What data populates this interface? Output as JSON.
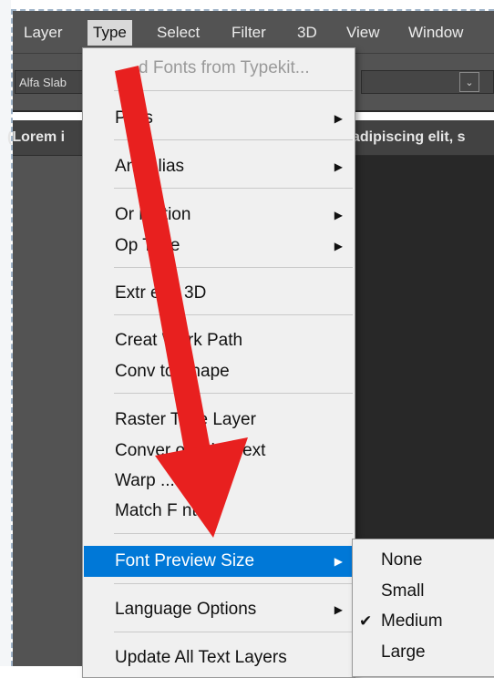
{
  "menubar": {
    "items": [
      "Layer",
      "Type",
      "Select",
      "Filter",
      "3D",
      "View",
      "Window"
    ]
  },
  "options": {
    "font": "Alfa Slab"
  },
  "document": {
    "text_left": "(Lorem i",
    "text_right": "adipiscing elit, s"
  },
  "type_menu": {
    "items": [
      {
        "label": "d Fonts from Typekit..."
      },
      {
        "label": "P  els"
      },
      {
        "label": "An  -Alias"
      },
      {
        "label": "Or  ntation"
      },
      {
        "label": "Op  Type"
      },
      {
        "label": "Extr   e to 3D"
      },
      {
        "label": "Creat  Work Path"
      },
      {
        "label": "Conv   to Shape"
      },
      {
        "label": "Raster   Type Layer"
      },
      {
        "label": "Conver   o Point Text"
      },
      {
        "label": "Warp     ..."
      },
      {
        "label": "Match F   nt..."
      },
      {
        "label": "Font Preview Size"
      },
      {
        "label": "Language Options"
      },
      {
        "label": "Update All Text Layers"
      }
    ]
  },
  "preview_submenu": {
    "items": [
      "None",
      "Small",
      "Medium",
      "Large"
    ],
    "checked": "Medium"
  },
  "colors": {
    "highlight": "#0078d7",
    "arrow": "#e8201f"
  },
  "icons": {
    "submenu_arrow": "triangle-right-icon",
    "check": "checkmark-icon",
    "annotation": "red-arrow-icon"
  }
}
